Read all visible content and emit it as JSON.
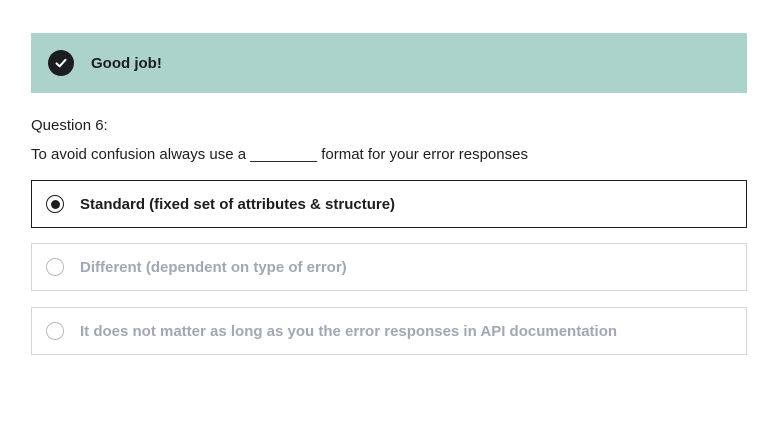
{
  "banner": {
    "icon": "check-circle-icon",
    "message": "Good job!",
    "background_color": "#acd2cc"
  },
  "question": {
    "number_label": "Question 6:",
    "prompt": "To avoid confusion always use a ________ format for your error responses"
  },
  "options": [
    {
      "label": "Standard (fixed set of attributes & structure)",
      "selected": true
    },
    {
      "label": "Different (dependent on type of error)",
      "selected": false
    },
    {
      "label": "It does not matter as long as you the error responses in API documentation",
      "selected": false
    }
  ]
}
